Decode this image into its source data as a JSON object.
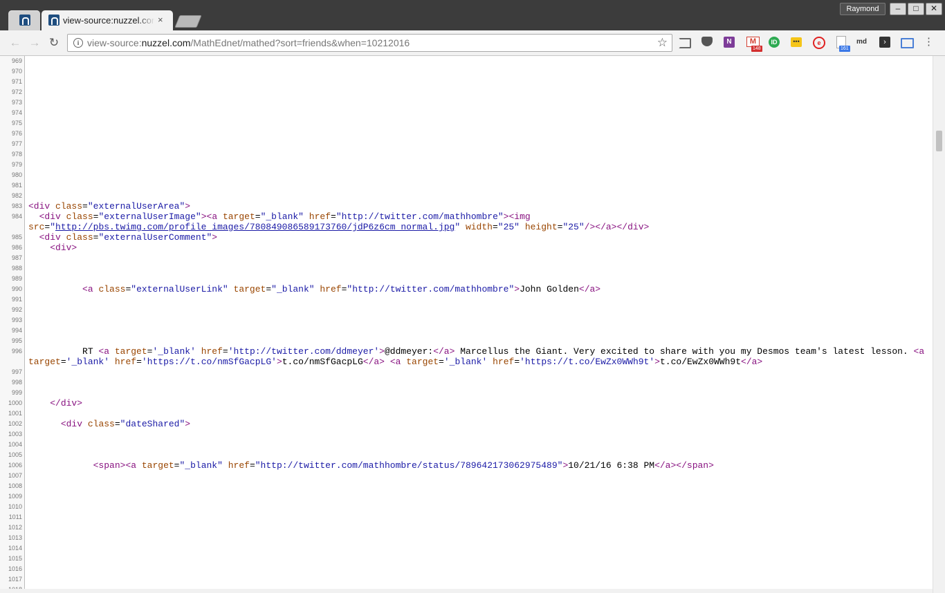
{
  "window": {
    "profile_name": "Raymond",
    "minimize": "–",
    "maximize": "□",
    "close": "✕"
  },
  "tabs": [
    {
      "title": "",
      "pinned": true,
      "favicon": "nuzzel-icon"
    },
    {
      "title": "view-source:nuzzel.com",
      "pinned": false,
      "favicon": "nuzzel-icon",
      "close": "×"
    }
  ],
  "toolbar": {
    "back": "←",
    "forward": "→",
    "reload": "↻",
    "url_scheme": "view-source:",
    "url_host": "nuzzel.com",
    "url_path": "/MathEdnet/mathed?sort=friends&when=10212016",
    "star": "☆",
    "extensions": {
      "onenote": "N",
      "gmail": "M",
      "gmail_badge": "148",
      "green": "ID",
      "yellow": "•••",
      "red": "e",
      "docs_badge": "161",
      "md": "md",
      "terminal": "›"
    },
    "menu": "⋮"
  },
  "source": {
    "lines": [
      {
        "n": "969",
        "html": ""
      },
      {
        "n": "970",
        "html": ""
      },
      {
        "n": "971",
        "html": ""
      },
      {
        "n": "972",
        "html": ""
      },
      {
        "n": "973",
        "html": ""
      },
      {
        "n": "974",
        "html": ""
      },
      {
        "n": "975",
        "html": ""
      },
      {
        "n": "976",
        "html": ""
      },
      {
        "n": "977",
        "html": ""
      },
      {
        "n": "978",
        "html": ""
      },
      {
        "n": "979",
        "html": ""
      },
      {
        "n": "980",
        "html": ""
      },
      {
        "n": "981",
        "html": ""
      },
      {
        "n": "982",
        "html": ""
      },
      {
        "n": "983",
        "html": "<span class=\"t\">&lt;div</span> <span class=\"a\">class</span>=<span class=\"v\">\"externalUserArea\"</span><span class=\"t\">&gt;</span>"
      },
      {
        "n": "984",
        "html": "  <span class=\"t\">&lt;div</span> <span class=\"a\">class</span>=<span class=\"v\">\"externalUserImage\"</span><span class=\"t\">&gt;</span><span class=\"t\">&lt;a</span> <span class=\"a\">target</span>=<span class=\"v\">\"_blank\"</span> <span class=\"a\">href</span>=<span class=\"v\">\"http://twitter.com/mathhombre\"</span><span class=\"t\">&gt;</span><span class=\"t\">&lt;img</span>\n<span class=\"a\">src</span>=<span class=\"v\">\"</span><span class=\"lnk\">http://pbs.twimg.com/profile_images/780849086589173760/jdP6z6cm_normal.jpg</span><span class=\"v\">\"</span> <span class=\"a\">width</span>=<span class=\"v\">\"25\"</span> <span class=\"a\">height</span>=<span class=\"v\">\"25\"</span><span class=\"t\">/&gt;</span><span class=\"t\">&lt;/a&gt;</span><span class=\"t\">&lt;/div&gt;</span>"
      },
      {
        "n": "985",
        "html": "  <span class=\"t\">&lt;div</span> <span class=\"a\">class</span>=<span class=\"v\">\"externalUserComment\"</span><span class=\"t\">&gt;</span>"
      },
      {
        "n": "986",
        "html": "    <span class=\"t\">&lt;div&gt;</span>"
      },
      {
        "n": "987",
        "html": ""
      },
      {
        "n": "988",
        "html": ""
      },
      {
        "n": "989",
        "html": ""
      },
      {
        "n": "990",
        "html": "          <span class=\"t\">&lt;a</span> <span class=\"a\">class</span>=<span class=\"v\">\"externalUserLink\"</span> <span class=\"a\">target</span>=<span class=\"v\">\"_blank\"</span> <span class=\"a\">href</span>=<span class=\"v\">\"http://twitter.com/mathhombre\"</span><span class=\"t\">&gt;</span>John Golden<span class=\"t\">&lt;/a&gt;</span>"
      },
      {
        "n": "991",
        "html": ""
      },
      {
        "n": "992",
        "html": ""
      },
      {
        "n": "993",
        "html": ""
      },
      {
        "n": "994",
        "html": ""
      },
      {
        "n": "995",
        "html": ""
      },
      {
        "n": "996",
        "html": "          RT <span class=\"t\">&lt;a</span> <span class=\"a\">target</span>=<span class=\"v\">'_blank'</span> <span class=\"a\">href</span>=<span class=\"v\">'http://twitter.com/ddmeyer'</span><span class=\"t\">&gt;</span>@ddmeyer:<span class=\"t\">&lt;/a&gt;</span> Marcellus the Giant. Very excited to share with you my Desmos team's latest lesson. <span class=\"t\">&lt;a</span>\n<span class=\"a\">target</span>=<span class=\"v\">'_blank'</span> <span class=\"a\">href</span>=<span class=\"v\">'https://t.co/nmSfGacpLG'</span><span class=\"t\">&gt;</span>t.co/nmSfGacpLG<span class=\"t\">&lt;/a&gt;</span> <span class=\"t\">&lt;a</span> <span class=\"a\">target</span>=<span class=\"v\">'_blank'</span> <span class=\"a\">href</span>=<span class=\"v\">'https://t.co/EwZx0WWh9t'</span><span class=\"t\">&gt;</span>t.co/EwZx0WWh9t<span class=\"t\">&lt;/a&gt;</span>"
      },
      {
        "n": "997",
        "html": ""
      },
      {
        "n": "998",
        "html": ""
      },
      {
        "n": "999",
        "html": ""
      },
      {
        "n": "1000",
        "html": "    <span class=\"t\">&lt;/div&gt;</span>"
      },
      {
        "n": "1001",
        "html": ""
      },
      {
        "n": "1002",
        "html": "      <span class=\"t\">&lt;div</span> <span class=\"a\">class</span>=<span class=\"v\">\"dateShared\"</span><span class=\"t\">&gt;</span>"
      },
      {
        "n": "1003",
        "html": ""
      },
      {
        "n": "1004",
        "html": ""
      },
      {
        "n": "1005",
        "html": ""
      },
      {
        "n": "1006",
        "html": "            <span class=\"t\">&lt;span&gt;</span><span class=\"t\">&lt;a</span> <span class=\"a\">target</span>=<span class=\"v\">\"_blank\"</span> <span class=\"a\">href</span>=<span class=\"v\">\"http://twitter.com/mathhombre/status/789642173062975489\"</span><span class=\"t\">&gt;</span>10/21/16 6:38 PM<span class=\"t\">&lt;/a&gt;</span><span class=\"t\">&lt;/span&gt;</span>"
      },
      {
        "n": "1007",
        "html": ""
      },
      {
        "n": "1008",
        "html": ""
      },
      {
        "n": "1009",
        "html": ""
      },
      {
        "n": "1010",
        "html": ""
      },
      {
        "n": "1011",
        "html": ""
      },
      {
        "n": "1012",
        "html": ""
      },
      {
        "n": "1013",
        "html": ""
      },
      {
        "n": "1014",
        "html": ""
      },
      {
        "n": "1015",
        "html": ""
      },
      {
        "n": "1016",
        "html": ""
      },
      {
        "n": "1017",
        "html": ""
      },
      {
        "n": "1018",
        "html": ""
      }
    ]
  }
}
